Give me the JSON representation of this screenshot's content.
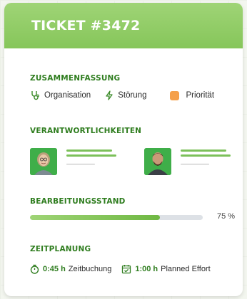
{
  "header": {
    "title": "TICKET #3472"
  },
  "summary": {
    "title": "ZUSAMMENFASSUNG",
    "items": [
      {
        "label": "Organisation",
        "icon": "stethoscope-icon"
      },
      {
        "label": "Störung",
        "icon": "lightning-icon"
      },
      {
        "label": "Priorität",
        "icon": "priority-square",
        "color": "#f5a04a"
      }
    ]
  },
  "responsibilities": {
    "title": "VERANTWORTLICHKEITEN",
    "people": [
      {
        "avatar": "avatar-woman"
      },
      {
        "avatar": "avatar-man"
      }
    ]
  },
  "progress": {
    "title": "BEARBEITUNGSSTAND",
    "percent": 75,
    "label": "75 %"
  },
  "schedule": {
    "title": "ZEITPLANUNG",
    "booked_value": "0:45 h",
    "booked_label": "Zeitbuchung",
    "planned_value": "1:00 h",
    "planned_label": "Planned Effort"
  },
  "colors": {
    "accent": "#86c65a",
    "section_title": "#2f7d1f",
    "priority": "#f5a04a"
  }
}
